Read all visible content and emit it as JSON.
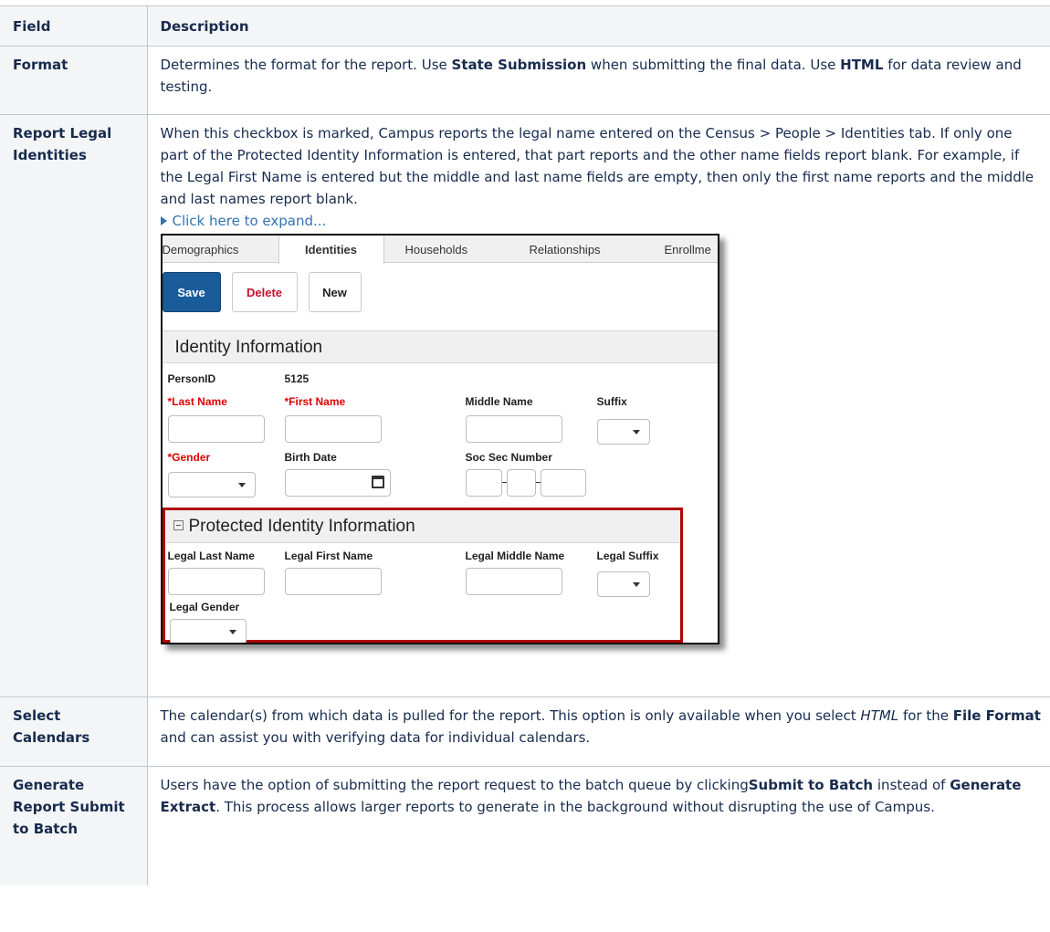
{
  "table": {
    "header": {
      "field": "Field",
      "description": "Description"
    },
    "rows": [
      {
        "field": "Format",
        "parts": [
          "Determines the format for the report. Use ",
          "State Submission",
          " when submitting the final data. Use ",
          "HTML",
          " for data review and testing."
        ]
      },
      {
        "field": "Report Legal Identities",
        "text": "When this checkbox is marked, Campus reports the legal name entered on the Census > People > Identities tab. If only one part of the Protected Identity Information is entered, that part reports and the other name fields report blank. For example, if the Legal First Name is entered but the middle and last name fields are empty, then only the first name reports and the middle and last names report blank.",
        "expand_label": "Click here to expand..."
      },
      {
        "field": "Select Calendars",
        "parts": [
          "The calendar(s) from which data is pulled for the report. This option is only available when you select ",
          "HTML",
          " for the ",
          "File Format",
          " and can assist you with verifying data for individual calendars."
        ]
      },
      {
        "field": "Generate Report Submit to Batch",
        "parts": [
          "Users have the option of submitting the report request to the batch queue by clicking",
          "Submit to Batch",
          " instead of ",
          "Generate Extract",
          ". This process allows larger reports to generate in the background without disrupting the use of Campus."
        ]
      }
    ]
  },
  "screenshot": {
    "tabs": [
      "Demographics",
      "Identities",
      "Households",
      "Relationships",
      "Enrollme"
    ],
    "active_tab": "Identities",
    "buttons": {
      "save": "Save",
      "delete": "Delete",
      "new": "New"
    },
    "identity_title": "Identity Information",
    "person_id_label": "PersonID",
    "person_id_value": "5125",
    "labels": {
      "last_name": "*Last Name",
      "first_name": "*First Name",
      "middle_name": "Middle Name",
      "suffix": "Suffix",
      "gender": "*Gender",
      "birth_date": "Birth Date",
      "ssn": "Soc Sec Number"
    },
    "protected_title": "Protected Identity Information",
    "protected_labels": {
      "legal_last": "Legal Last Name",
      "legal_first": "Legal First Name",
      "legal_middle": "Legal Middle Name",
      "legal_suffix": "Legal Suffix",
      "legal_gender": "Legal Gender"
    },
    "highlight_color": "#b00000",
    "save_color": "#1a5b9a",
    "required_color": "#e00000"
  }
}
